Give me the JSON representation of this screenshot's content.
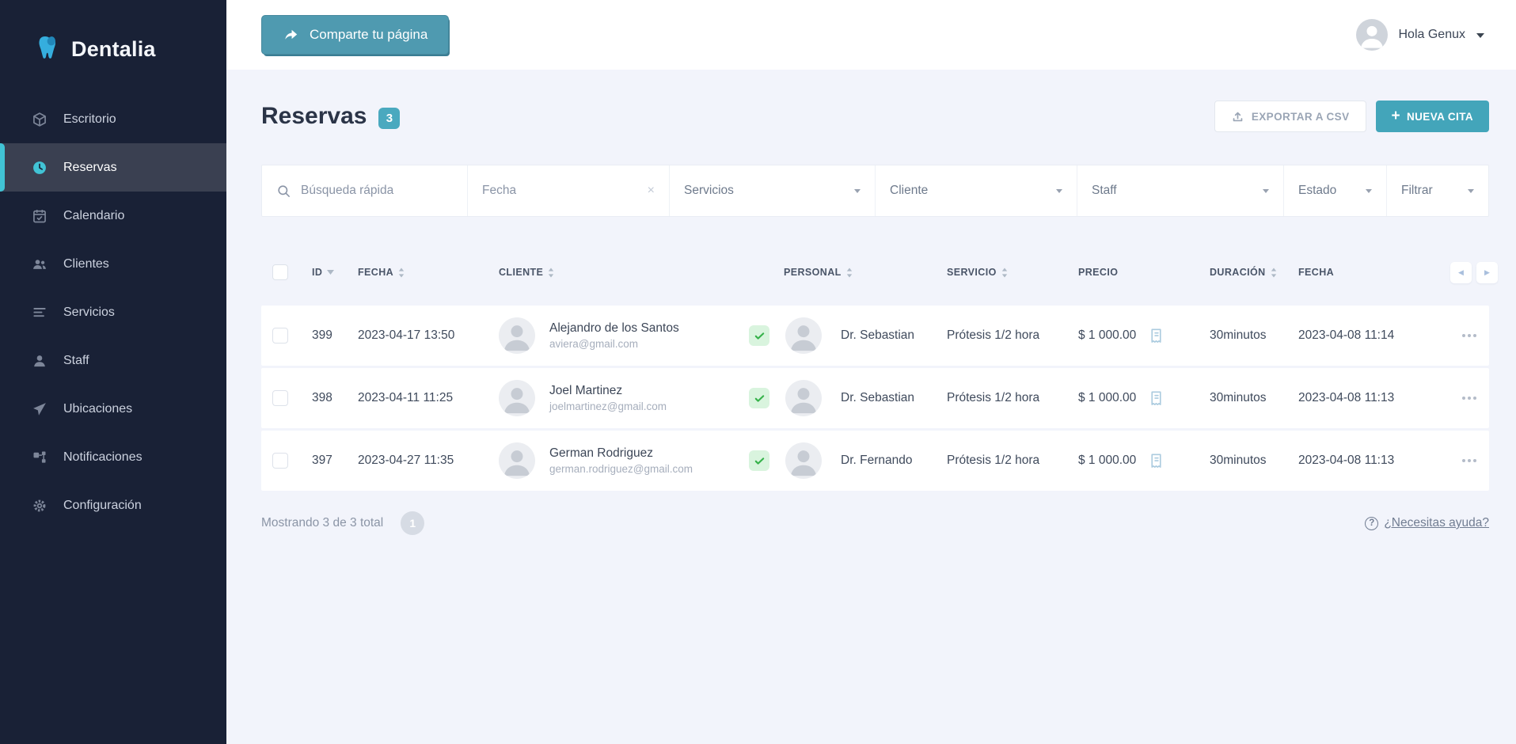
{
  "brand": {
    "name": "Dentalia"
  },
  "topbar": {
    "share_label": "Comparte tu página",
    "greeting": "Hola Genux"
  },
  "sidebar": {
    "items": [
      {
        "key": "escritorio",
        "label": "Escritorio",
        "icon": "desk-icon",
        "active": false
      },
      {
        "key": "reservas",
        "label": "Reservas",
        "icon": "clock-icon",
        "active": true
      },
      {
        "key": "calendario",
        "label": "Calendario",
        "icon": "calendar-icon",
        "active": false
      },
      {
        "key": "clientes",
        "label": "Clientes",
        "icon": "clients-icon",
        "active": false
      },
      {
        "key": "servicios",
        "label": "Servicios",
        "icon": "services-icon",
        "active": false
      },
      {
        "key": "staff",
        "label": "Staff",
        "icon": "staff-icon",
        "active": false
      },
      {
        "key": "ubicaciones",
        "label": "Ubicaciones",
        "icon": "locations-icon",
        "active": false
      },
      {
        "key": "notificaciones",
        "label": "Notificaciones",
        "icon": "notifications-icon",
        "active": false
      },
      {
        "key": "configuracion",
        "label": "Configuración",
        "icon": "settings-icon",
        "active": false
      }
    ]
  },
  "page": {
    "title": "Reservas",
    "count": "3",
    "export_label": "EXPORTAR A CSV",
    "new_label": "NUEVA CITA"
  },
  "filters": {
    "search_placeholder": "Búsqueda rápida",
    "fecha_placeholder": "Fecha",
    "servicios": "Servicios",
    "cliente": "Cliente",
    "staff": "Staff",
    "estado": "Estado",
    "filtrar": "Filtrar"
  },
  "table": {
    "columns": {
      "id": "ID",
      "fecha": "FECHA",
      "cliente": "CLIENTE",
      "personal": "PERSONAL",
      "servicio": "SERVICIO",
      "precio": "PRECIO",
      "duracion": "DURACIÓN",
      "fecha_registro": "FECHA"
    },
    "rows": [
      {
        "id": "399",
        "fecha": "2023-04-17 13:50",
        "cliente": {
          "name": "Alejandro de los Santos",
          "email": "aviera@gmail.com"
        },
        "personal": "Dr. Sebastian",
        "servicio": "Prótesis 1/2 hora",
        "precio": "$ 1 000.00",
        "duracion": "30minutos",
        "registrada": "2023-04-08 11:14"
      },
      {
        "id": "398",
        "fecha": "2023-04-11 11:25",
        "cliente": {
          "name": "Joel Martinez",
          "email": "joelmartinez@gmail.com"
        },
        "personal": "Dr. Sebastian",
        "servicio": "Prótesis 1/2 hora",
        "precio": "$ 1 000.00",
        "duracion": "30minutos",
        "registrada": "2023-04-08 11:13"
      },
      {
        "id": "397",
        "fecha": "2023-04-27 11:35",
        "cliente": {
          "name": "German Rodriguez",
          "email": "german.rodriguez@gmail.com"
        },
        "personal": "Dr. Fernando",
        "servicio": "Prótesis 1/2 hora",
        "precio": "$ 1 000.00",
        "duracion": "30minutos",
        "registrada": "2023-04-08 11:13"
      }
    ]
  },
  "footer": {
    "showing": "Mostrando 3 de 3 total",
    "page": "1",
    "help": "¿Necesitas ayuda?"
  },
  "colors": {
    "sidebar_bg": "#192136",
    "accent_teal": "#43a5ba",
    "active_cyan": "#41c3d5",
    "success_green": "#36b24a",
    "page_bg": "#f2f4fb"
  }
}
